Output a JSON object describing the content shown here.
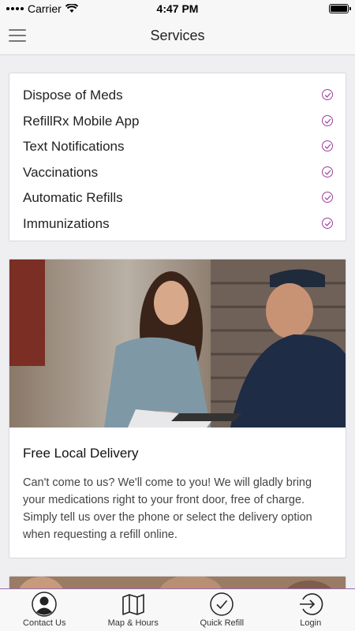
{
  "status_bar": {
    "carrier": "Carrier",
    "time": "4:47 PM"
  },
  "nav": {
    "title": "Services",
    "menu_icon": "hamburger-menu-icon"
  },
  "services": [
    {
      "label": "Dispose of Meds"
    },
    {
      "label": "RefillRx Mobile App"
    },
    {
      "label": "Text Notifications"
    },
    {
      "label": "Vaccinations"
    },
    {
      "label": "Automatic Refills"
    },
    {
      "label": "Immunizations"
    }
  ],
  "delivery": {
    "title": "Free Local Delivery",
    "body": "Can't come to us? We'll come to you! We will gladly bring your medications right to your front door, free of charge. Simply tell us over the phone or select the delivery option when requesting a refill online."
  },
  "tabs": [
    {
      "label": "Contact Us",
      "icon": "user-icon"
    },
    {
      "label": "Map & Hours",
      "icon": "map-icon"
    },
    {
      "label": "Quick Refill",
      "icon": "checkmark-circle-icon"
    },
    {
      "label": "Login",
      "icon": "login-icon"
    }
  ],
  "colors": {
    "accent": "#9c3f9c",
    "tab_border": "#9c6bb0"
  }
}
